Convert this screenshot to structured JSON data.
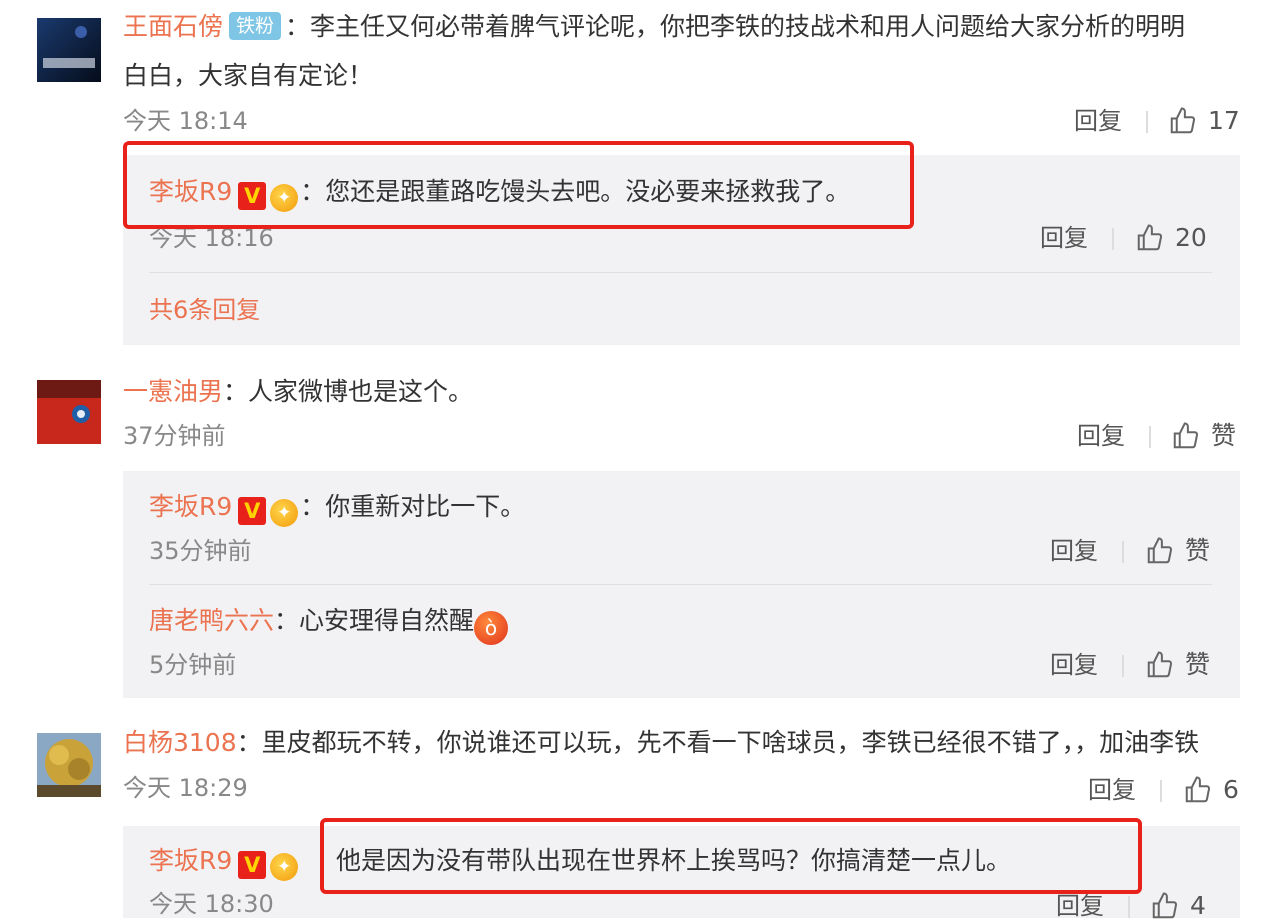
{
  "comments": [
    {
      "username": "王面石傍",
      "badge": "铁粉",
      "text": "：李主任又何必带着脾气评论呢，你把李铁的技战术和用人问题给大家分析的明明",
      "text_line2": "白白，大家自有定论！",
      "time": "今天 18:14",
      "reply_label": "回复",
      "likes": "17",
      "replies": [
        {
          "username": "李​坂R9",
          "text": "：您还是跟董路吃馒头去吧。没必要来拯救我了。",
          "time": "今天 18:16",
          "reply_label": "回复",
          "likes": "20"
        }
      ],
      "total_replies": "共6条回复"
    },
    {
      "username": "一憲油男",
      "text": "：人家微博也是这个。",
      "time": "37分钟前",
      "reply_label": "回复",
      "likes": "赞",
      "replies": [
        {
          "username": "李​坂R9",
          "text": "：你重新对比一下。",
          "time": "35分钟前",
          "reply_label": "回复",
          "likes": "赞"
        },
        {
          "username": "唐老鸭六六",
          "text": "：心安理得自然醒",
          "time": "5分钟前",
          "reply_label": "回复",
          "likes": "赞"
        }
      ]
    },
    {
      "username": "白杨3108",
      "text": "：里皮都玩不转，你说谁还可以玩，先不看一下啥球员，李铁已经很不错了，，加油李铁",
      "time": "今天 18:29",
      "reply_label": "回复",
      "likes": "6",
      "replies": [
        {
          "username": "李​坂R9",
          "text": "他是因为没有带队出现在世界杯上挨骂吗？你搞清楚一点儿。",
          "time": "今天 18:30",
          "reply_label": "回复",
          "likes": "4"
        }
      ]
    }
  ],
  "icons": {
    "vip_badge": "V",
    "medal": "fan-medal-icon",
    "emoji": "angry-face-emoji",
    "thumb": "thumb-up-icon"
  },
  "colors": {
    "username": "#eb7350",
    "highlight_box": "#e8211b",
    "subreply_bg": "#f2f2f5",
    "badge_tag": "#7fc6e6"
  }
}
